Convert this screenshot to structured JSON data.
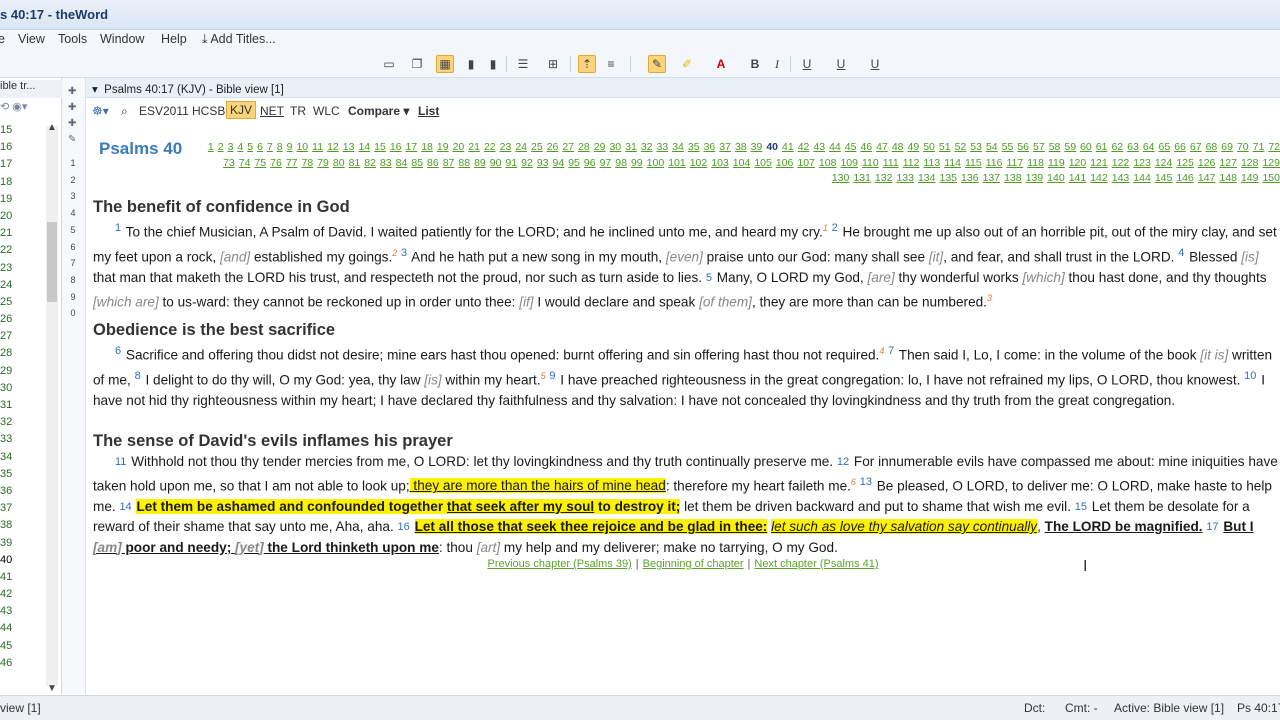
{
  "app": {
    "title": "s 40:17 - theWord"
  },
  "menu": {
    "view": "View",
    "tools": "Tools",
    "window": "Window",
    "help": "Help",
    "add_titles": "Add Titles..."
  },
  "left_panel": {
    "header": "ible tr...",
    "numbers": [
      "15",
      "16",
      "17",
      "18",
      "19",
      "20",
      "21",
      "22",
      "23",
      "24",
      "25",
      "26",
      "27",
      "28",
      "29",
      "30",
      "31",
      "32",
      "33",
      "34",
      "35",
      "36",
      "37",
      "38",
      "39",
      "40",
      "41",
      "42",
      "43",
      "44",
      "45",
      "46"
    ]
  },
  "gutter": {
    "lines": [
      "1",
      "2",
      "3",
      "4",
      "5",
      "6",
      "7",
      "8",
      "9",
      "0"
    ]
  },
  "view": {
    "caption": "Psalms 40:17 (KJV)  - Bible view [1]"
  },
  "bible_toolbar": {
    "esv": "ESV2011",
    "hcsb": "HCSB",
    "kjv": "KJV",
    "net": "NET",
    "tr": "TR",
    "wlc": "WLC",
    "compare": "Compare",
    "list": "List"
  },
  "chapter": {
    "title": "Psalms 40",
    "current": "40"
  },
  "headings": {
    "h1": "The benefit of confidence in God",
    "h2": "Obedience is the best sacrifice",
    "h3": "The sense of David's evils inflames his prayer"
  },
  "nav": {
    "prev": "Previous chapter (Psalms 39)",
    "begin": "Beginning of chapter",
    "next": "Next chapter (Psalms 41)"
  },
  "status": {
    "left": "view [1]",
    "dct": "Dct:",
    "cmt": "Cmt: -",
    "active": "Active: Bible view [1]",
    "ref": "Ps 40:17"
  }
}
